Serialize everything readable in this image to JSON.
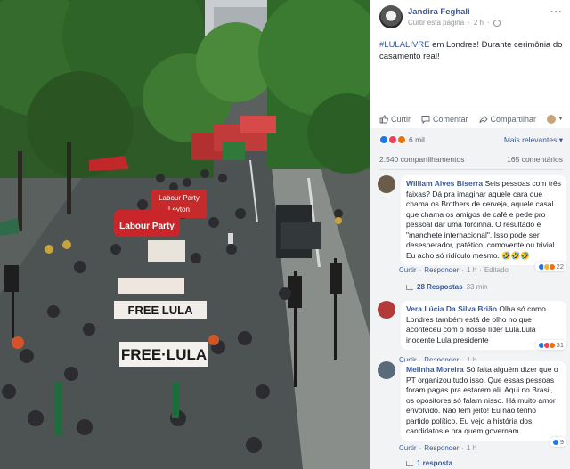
{
  "photo": {
    "banners": [
      "Labour Party",
      "Leyton",
      "Labour Party",
      "FREE LULA",
      "FREE LULA",
      "FREE·LULA"
    ]
  },
  "post": {
    "author": "Jandira Feghali",
    "follow_label": "Curtir esta página",
    "time": "2 h",
    "more_icon": "more-dots-icon",
    "hashtag": "#LULALIVRE",
    "text": " em Londres! Durante cerimônia do casamento real!"
  },
  "actions": {
    "like": "Curtir",
    "comment": "Comentar",
    "share": "Compartilhar"
  },
  "stats": {
    "reactions_count": "6 mil",
    "relevance_label": "Mais relevantes",
    "shares": "2.540 compartilhamentos",
    "comments": "165 comentários"
  },
  "comments": [
    {
      "name": "William Alves Biserra",
      "text": " Seis pessoas com três faixas? Dá pra imaginar aquele cara que chama os Brothers de cerveja, aquele casal que chama os amigos de café e pede pro pessoal dar uma forcinha. O resultado é \"manchete internacional\". Isso pode ser desesperador, patético, comovente ou trivial. Eu acho só ridículo mesmo.",
      "emojis": "🤣🤣🤣",
      "like": "Curtir",
      "reply": "Responder",
      "time": "1 h",
      "edited": "Editado",
      "reactions": "22",
      "replies": "28 Respostas",
      "replies_time": "33 min",
      "avatar_color": "#6b5b4b"
    },
    {
      "name": "Vera Lúcia Da Silva Brião",
      "text": " Olha só como Londres também está de olho no que aconteceu com o nosso líder Lula.Lula inocente Lula presidente",
      "like": "Curtir",
      "reply": "Responder",
      "time": "1 h",
      "reactions": "31",
      "avatar_color": "#b23a3a"
    },
    {
      "name": "Melinha Moreira",
      "text": " Só falta alguém dizer que o PT organizou tudo isso. Que essas pessoas foram pagas pra estarem ali. Aqui no Brasil, os opositores só falam nisso. Há muito amor envolvido. Não tem jeito! Eu não tenho partido político. Eu vejo a história dos candidatos e pra quem governam.",
      "like": "Curtir",
      "reply": "Responder",
      "time": "1 h",
      "reactions": "9",
      "replies": "1 resposta",
      "avatar_color": "#5a6a7a"
    }
  ],
  "colors": {
    "link": "#385898",
    "muted": "#90949c",
    "feed_bg": "#f2f3f5"
  }
}
